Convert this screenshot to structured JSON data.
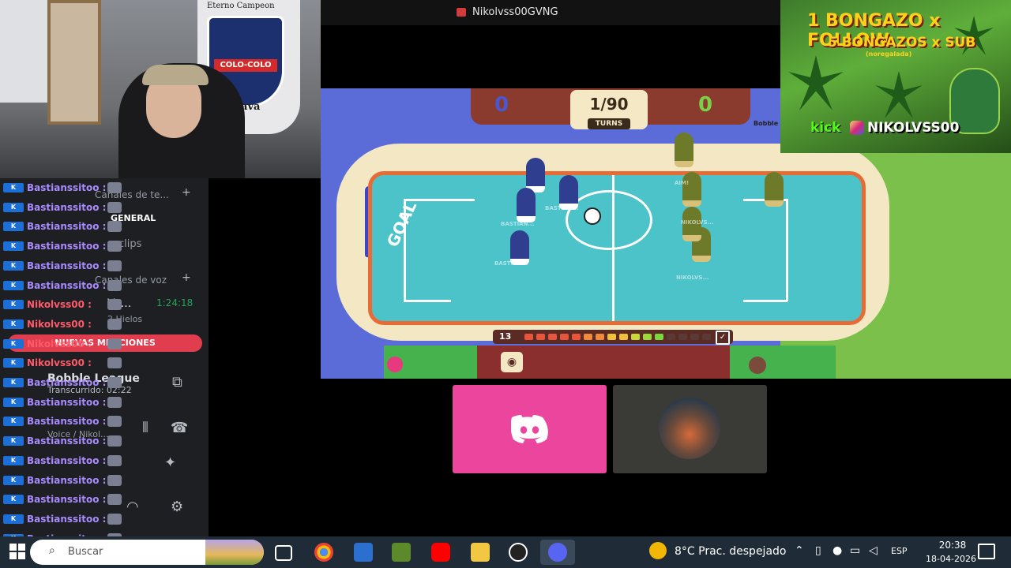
{
  "webcam": {
    "crest_text": "COLO-COLO",
    "banner_top": "Eterno Campeon",
    "banner_bottom": "Raja Brava"
  },
  "discord": {
    "text_channels_header": "Canales de te...",
    "general_channel": "GENERAL",
    "clips_channel": "clips",
    "voice_channels_header": "Canales de voz",
    "voice_channel": "Vo...",
    "voice_timer": "1:24:18",
    "voice_members": "2 Hielos",
    "mentions_label": "NUEVAS MENCIONES",
    "activity_title": "Bobble League",
    "activity_sub": "Transcurrido: 02:22",
    "bottom_voice": "Voice / Nikol..."
  },
  "chat": [
    {
      "name": "Bastianssitoo :",
      "color": "#a98bff"
    },
    {
      "name": "Bastianssitoo :",
      "color": "#a98bff"
    },
    {
      "name": "Bastianssitoo :",
      "color": "#a98bff"
    },
    {
      "name": "Bastianssitoo :",
      "color": "#a98bff"
    },
    {
      "name": "Bastianssitoo :",
      "color": "#a98bff"
    },
    {
      "name": "Bastianssitoo :",
      "color": "#a98bff"
    },
    {
      "name": "Nikolvss00 :",
      "color": "#ff5a6a"
    },
    {
      "name": "Nikolvss00 :",
      "color": "#ff5a6a"
    },
    {
      "name": "Nikolvss00 :",
      "color": "#ff5a6a"
    },
    {
      "name": "Nikolvss00 :",
      "color": "#ff5a6a"
    },
    {
      "name": "Bastianssitoo :",
      "color": "#a98bff"
    },
    {
      "name": "Bastianssitoo :",
      "color": "#a98bff"
    },
    {
      "name": "Bastianssitoo :",
      "color": "#a98bff"
    },
    {
      "name": "Bastianssitoo :",
      "color": "#a98bff"
    },
    {
      "name": "Bastianssitoo :",
      "color": "#a98bff"
    },
    {
      "name": "Bastianssitoo :",
      "color": "#a98bff"
    },
    {
      "name": "Bastianssitoo :",
      "color": "#a98bff"
    },
    {
      "name": "Bastianssitoo :",
      "color": "#a98bff"
    },
    {
      "name": "Bastianssitoo :",
      "color": "#a98bff"
    },
    {
      "name": "Bastianssitoo :",
      "color": "#a98bff"
    }
  ],
  "stream": {
    "window_title": "Nikolvss00GVNG"
  },
  "game": {
    "score_left": "0",
    "score_right": "0",
    "turns_value": "1/90",
    "turns_label": "TURNS",
    "goal_label": "GOAL",
    "power_value": "13",
    "player_tag_blue": "BASTIAN...",
    "player_tag_green": "NIKOLVS...",
    "right_label": "Bobble League",
    "aim_label": "AIM!"
  },
  "ad": {
    "line1": "1 BONGAZO x FOLLOW",
    "line2": "5 BONGAZOS x SUB",
    "line3": "(noregalada)",
    "kick": "kick",
    "handle": "NIKOLVSS00"
  },
  "taskbar": {
    "search_placeholder": "Buscar",
    "weather": "8°C  Prac. despejado",
    "language": "ESP",
    "time": "20:38",
    "date": "18-04-2026"
  },
  "colors": {
    "discord_pink": "#eb459e",
    "mention_red": "#e03e4f",
    "field": "#4cc3c9",
    "brand_blue": "#5865f2"
  }
}
